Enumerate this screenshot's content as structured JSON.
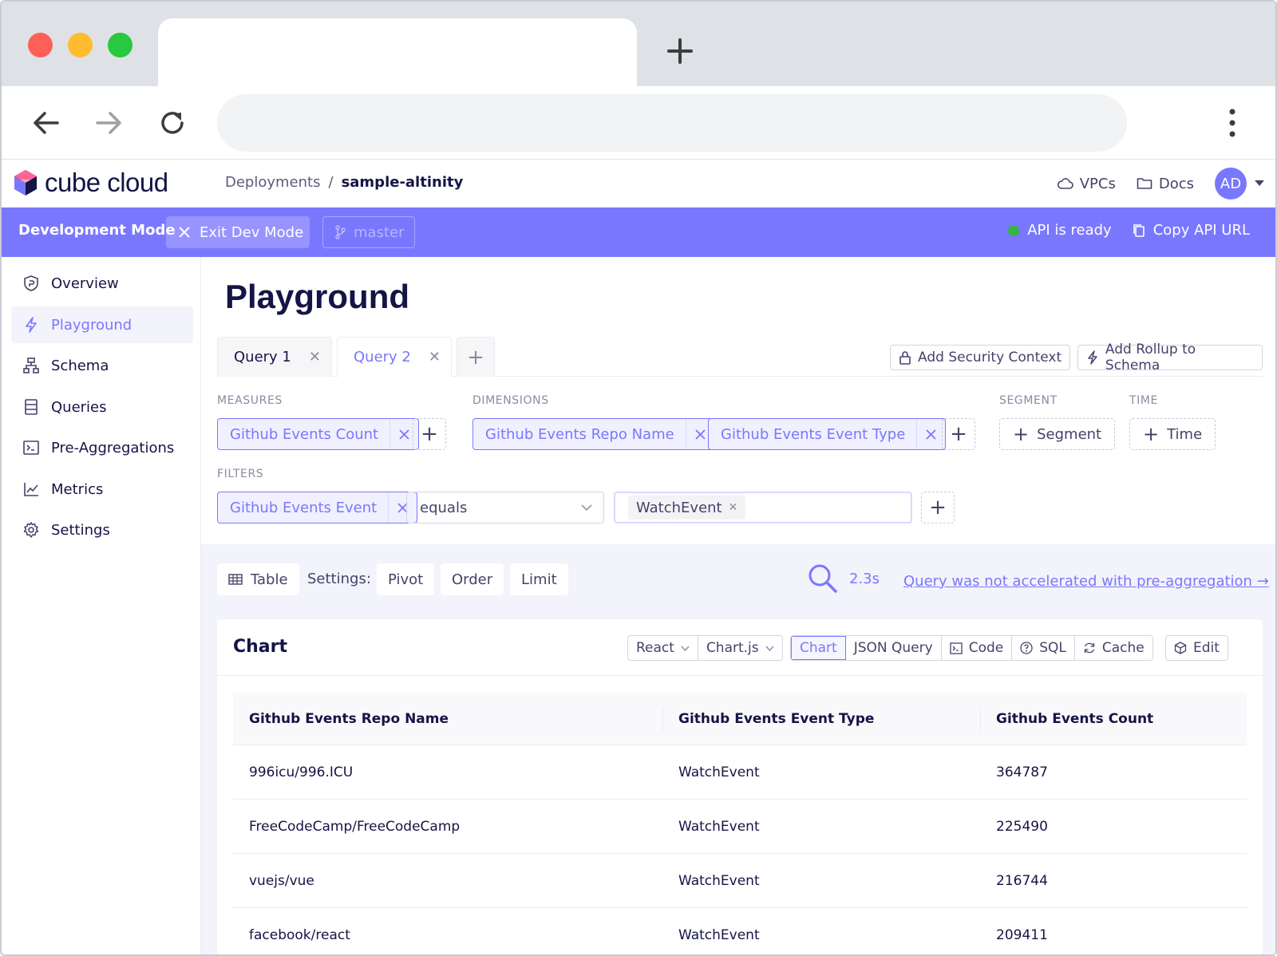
{
  "app": {
    "logo_text": "cube cloud",
    "breadcrumb": [
      "Deployments",
      "sample-altinity"
    ],
    "header_links": [
      "VPCs",
      "Docs"
    ],
    "avatar_initials": "AD",
    "brand_color": "#7a77ff"
  },
  "devbar": {
    "mode_label": "Development Mode",
    "exit_label": "Exit Dev Mode",
    "branch_label": "master",
    "api_status": "API is ready",
    "copy_api_label": "Copy API URL"
  },
  "sidebar": {
    "items": [
      {
        "label": "Overview",
        "icon": "shield-icon"
      },
      {
        "label": "Playground",
        "icon": "bolt-icon",
        "active": true
      },
      {
        "label": "Schema",
        "icon": "schema-icon"
      },
      {
        "label": "Queries",
        "icon": "queries-icon"
      },
      {
        "label": "Pre-Aggregations",
        "icon": "terminal-icon"
      },
      {
        "label": "Metrics",
        "icon": "chart-line-icon"
      },
      {
        "label": "Settings",
        "icon": "gear-icon"
      }
    ]
  },
  "main": {
    "title": "Playground",
    "tabs": [
      {
        "label": "Query 1",
        "active": false
      },
      {
        "label": "Query 2",
        "active": true
      }
    ],
    "actions": {
      "security_context": "Add Security Context",
      "rollup": "Add Rollup to Schema"
    },
    "measures": {
      "label": "MEASURES",
      "items": [
        "Github Events Count"
      ]
    },
    "dimensions": {
      "label": "DIMENSIONS",
      "items": [
        "Github Events Repo Name",
        "Github Events Event Type"
      ]
    },
    "segment": {
      "label": "SEGMENT",
      "button": "Segment"
    },
    "time": {
      "label": "TIME",
      "button": "Time"
    },
    "filters": {
      "label": "FILTERS",
      "member": "Github Events Event",
      "operator": "equals",
      "values": [
        "WatchEvent"
      ]
    },
    "results_bar": {
      "view_label": "Table",
      "settings_label": "Settings:",
      "settings": [
        "Pivot",
        "Order",
        "Limit"
      ],
      "timing": "2.3s",
      "accel_link": "Query was not accelerated with pre-aggregation →"
    },
    "chart": {
      "title": "Chart",
      "framework": "React",
      "library": "Chart.js",
      "views": [
        "Chart",
        "JSON Query",
        "Code",
        "SQL",
        "Cache"
      ],
      "active_view": "Chart",
      "edit_label": "Edit"
    },
    "table": {
      "columns": [
        "Github Events Repo Name",
        "Github Events Event Type",
        "Github Events Count"
      ],
      "rows": [
        [
          "996icu/996.ICU",
          "WatchEvent",
          "364787"
        ],
        [
          "FreeCodeCamp/FreeCodeCamp",
          "WatchEvent",
          "225490"
        ],
        [
          "vuejs/vue",
          "WatchEvent",
          "216744"
        ],
        [
          "facebook/react",
          "WatchEvent",
          "209411"
        ]
      ]
    }
  }
}
